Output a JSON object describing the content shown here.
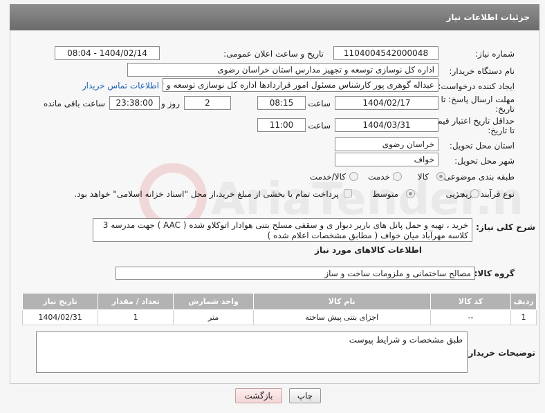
{
  "header": {
    "title": "جزئیات اطلاعات نیاز"
  },
  "form": {
    "need_number_label": "شماره نیاز:",
    "need_number": "1104004542000048",
    "announce_label": "تاریخ و ساعت اعلان عمومی:",
    "announce_value": "1404/02/14 - 08:04",
    "buyer_org_label": "نام دستگاه خریدار:",
    "buyer_org": "اداره کل نوسازی  توسعه و تجهیز مدارس استان خراسان رضوی",
    "requester_label": "ایجاد کننده درخواست:",
    "requester": "عبداله گوهری پور کارشناس مسئول امور قراردادها  اداره کل نوسازی  توسعه و تجهیز مدارس استان خراسان رضوی",
    "contact_link": "اطلاعات تماس خریدار",
    "deadline_label": "مهلت ارسال پاسخ: تا تاریخ:",
    "deadline_date": "1404/02/17",
    "time_label": "ساعت",
    "deadline_time": "08:15",
    "days_value": "2",
    "days_label": "روز و",
    "remaining_time": "23:38:00",
    "remaining_label": "ساعت باقی مانده",
    "validity_label": "حداقل تاریخ اعتبار قیمت: تا تاریخ:",
    "validity_date": "1404/03/31",
    "validity_time": "11:00",
    "province_label": "استان محل تحویل:",
    "province": "خراسان رضوی",
    "city_label": "شهر محل تحویل:",
    "city": "خواف",
    "category_label": "طبقه بندی موضوعی:",
    "category_options": [
      "کالا",
      "خدمت",
      "کالا/خدمت"
    ],
    "purchase_type_label": "نوع فرآیند خرید :",
    "purchase_type_options": [
      "جزیی",
      "متوسط"
    ],
    "payment_note": "پرداخت تمام یا بخشی از مبلغ خرید،از محل \"اسناد خزانه اسلامی\" خواهد بود.",
    "general_desc_label": "شرح کلی نیاز:",
    "general_desc": "خرید ، تهیه و حمل پانل های باربر دیوار ی و سقفی مسلح بتنی هوادار اتوکلاو شده ( AAC ) جهت مدرسه 3 کلاسه مهرآباد میان خواف ( مطابق مشخصات اعلام شده )"
  },
  "goods": {
    "section_title": "اطلاعات کالاهای مورد نیاز",
    "group_label": "گروه کالا:",
    "group_value": "مصالح ساختمانی و ملزومات ساخت و ساز",
    "table": {
      "headers": [
        "ردیف",
        "کد کالا",
        "نام کالا",
        "واحد شمارش",
        "تعداد / مقدار",
        "تاریخ نیاز"
      ],
      "rows": [
        [
          "1",
          "--",
          "اجزای بتنی پیش ساخته",
          "متر",
          "1",
          "1404/02/31"
        ]
      ]
    }
  },
  "buyer_notes": {
    "label": "توضیحات خریدار:",
    "value": "طبق مشخصات و شرایط پیوست"
  },
  "buttons": {
    "print": "چاپ",
    "back": "بازگشت"
  },
  "watermark": {
    "text": "AriaTender.neT"
  }
}
